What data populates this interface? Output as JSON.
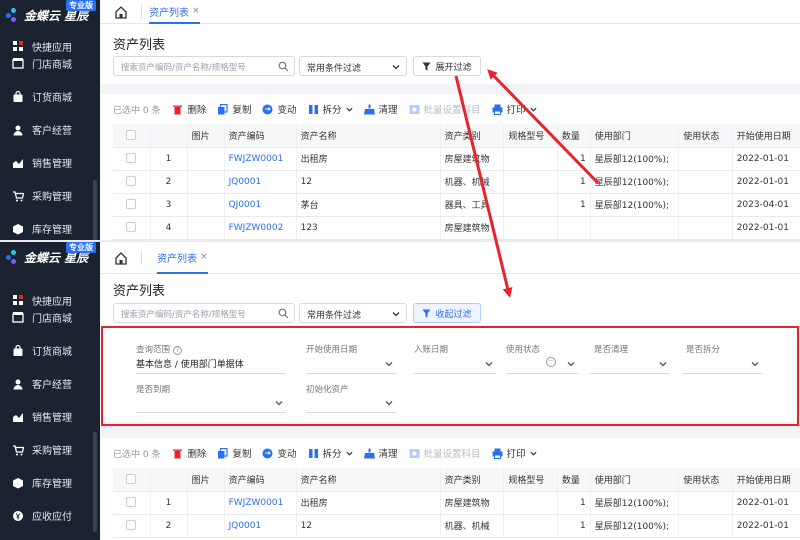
{
  "app": {
    "brand": "金蝶云 星辰",
    "edition": "专业版"
  },
  "tab": {
    "label": "资产列表",
    "close": "×"
  },
  "page_title": "资产列表",
  "search": {
    "placeholder": "搜索资产编码/资产名称/规格型号"
  },
  "filter_select": {
    "value": "常用条件过滤"
  },
  "filter_toggle": {
    "expand_label": "展开过滤",
    "collapse_label": "收起过滤"
  },
  "sidebar": {
    "top_items": [
      {
        "label": "快捷应用",
        "icon": "grid-icon"
      },
      {
        "label": "门店商城",
        "icon": "store-icon"
      },
      {
        "label": "订货商城",
        "icon": "bag-icon"
      },
      {
        "label": "客户经营",
        "icon": "person-icon"
      },
      {
        "label": "销售管理",
        "icon": "chart-icon"
      },
      {
        "label": "采购管理",
        "icon": "cart-icon"
      },
      {
        "label": "库存管理",
        "icon": "box-icon"
      }
    ],
    "bottom_items": [
      {
        "label": "快捷应用",
        "icon": "grid-icon"
      },
      {
        "label": "门店商城",
        "icon": "store-icon"
      },
      {
        "label": "订货商城",
        "icon": "bag-icon"
      },
      {
        "label": "客户经营",
        "icon": "person-icon"
      },
      {
        "label": "销售管理",
        "icon": "chart-icon"
      },
      {
        "label": "采购管理",
        "icon": "cart-icon"
      },
      {
        "label": "库存管理",
        "icon": "box-icon"
      },
      {
        "label": "应收应付",
        "icon": "money-icon"
      }
    ]
  },
  "filters": {
    "scope_label": "查询范围",
    "scope_value": "基本信息 / 使用部门单据体",
    "start_date_label": "开始使用日期",
    "entry_date_label": "入账日期",
    "status_label": "使用状态",
    "cleared_label": "是否清理",
    "split_label": "是否拆分",
    "expired_label": "是否到期",
    "initial_label": "初始化资产",
    "more_icon": "···"
  },
  "toolbar": {
    "selected": "已选中 0 条",
    "delete": "删除",
    "copy": "复制",
    "change": "变动",
    "split": "拆分",
    "clear": "清理",
    "batch_subject": "批量设置科目",
    "print": "打印"
  },
  "table": {
    "headers": [
      "",
      "",
      "图片",
      "资产编码",
      "资产名称",
      "资产类别",
      "规格型号",
      "数量",
      "使用部门",
      "使用状态",
      "开始使用日期"
    ],
    "rows_top": [
      {
        "no": "1",
        "code": "FWJZW0001",
        "name": "出租房",
        "category": "房屋建筑物",
        "spec": "",
        "qty": "1",
        "dept": "星辰部12(100%);",
        "status": "",
        "date": "2022-01-01"
      },
      {
        "no": "2",
        "code": "JQ0001",
        "name": "12",
        "category": "机器、机械",
        "spec": "",
        "qty": "1",
        "dept": "星辰部12(100%);",
        "status": "",
        "date": "2022-01-01"
      },
      {
        "no": "3",
        "code": "QJ0001",
        "name": "茅台",
        "category": "器具、工具",
        "spec": "",
        "qty": "1",
        "dept": "星辰部12(100%);",
        "status": "",
        "date": "2023-04-01"
      },
      {
        "no": "4",
        "code": "FWJZW0002",
        "name": "123",
        "category": "房屋建筑物",
        "spec": "",
        "qty": "",
        "dept": "",
        "status": "",
        "date": "2022-01-01"
      }
    ],
    "rows_bottom": [
      {
        "no": "1",
        "code": "FWJZW0001",
        "name": "出租房",
        "category": "房屋建筑物",
        "spec": "",
        "qty": "1",
        "dept": "星辰部12(100%);",
        "status": "",
        "date": "2022-01-01"
      },
      {
        "no": "2",
        "code": "JQ0001",
        "name": "12",
        "category": "机器、机械",
        "spec": "",
        "qty": "1",
        "dept": "星辰部12(100%);",
        "status": "",
        "date": "2022-01-01"
      }
    ]
  },
  "colors": {
    "accent": "#2b6ff5",
    "sidebar": "#1b2230",
    "annotation": "#e8232b"
  }
}
